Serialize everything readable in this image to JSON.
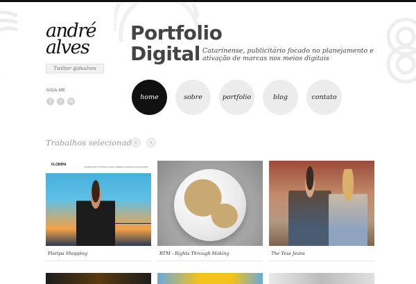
{
  "logo": {
    "line1": "andré",
    "line2": "alves"
  },
  "twitter_handle": "Twitter @dealves",
  "social": {
    "label": "SIGA-ME",
    "icons": [
      {
        "name": "facebook-icon",
        "glyph": "f"
      },
      {
        "name": "twitter-icon",
        "glyph": "t"
      },
      {
        "name": "linkedin-icon",
        "glyph": "in"
      }
    ]
  },
  "header": {
    "title_line1": "Portfolio",
    "title_line2": "Digital",
    "tagline": "Catarinense, publicitário focado no planejamento e ativação de marcas nos meios digitais"
  },
  "nav": {
    "items": [
      {
        "label": "home",
        "active": true
      },
      {
        "label": "sobre",
        "active": false
      },
      {
        "label": "portfolio",
        "active": false
      },
      {
        "label": "blog",
        "active": false
      },
      {
        "label": "contato",
        "active": false
      }
    ]
  },
  "works": {
    "title": "Trabalhos selecionados",
    "prev": "‹",
    "next": "›",
    "items": [
      {
        "caption": "Floripa Shopping",
        "brand": "FLORIPA",
        "menu": "HOME  INSTITUCIONAL  LOJAS  CINEMA  ACONTECE NO FLORIPA"
      },
      {
        "caption": "RTM - Rights Through Making"
      },
      {
        "caption": "The Tess Jeans"
      }
    ]
  },
  "colors": {
    "accent": "#111111",
    "nav_bg": "#ececec",
    "muted_text": "#9a9a9a"
  }
}
